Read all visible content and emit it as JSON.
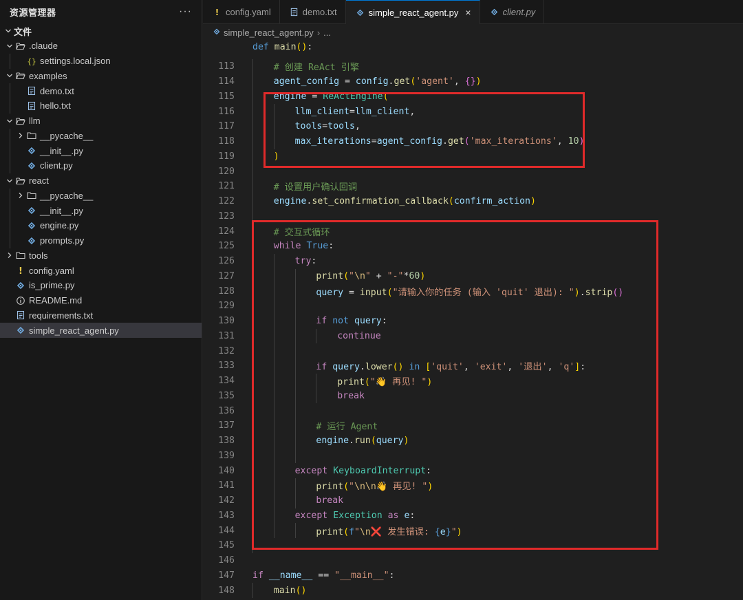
{
  "sidebar": {
    "title": "资源管理器",
    "more": "···",
    "section": "文件",
    "items": [
      {
        "label": ".claude",
        "depth": 1,
        "kind": "folder-open",
        "icon": "folder-icon"
      },
      {
        "label": "settings.local.json",
        "depth": 2,
        "kind": "json",
        "icon": "json-file-icon"
      },
      {
        "label": "examples",
        "depth": 1,
        "kind": "folder-open",
        "icon": "folder-icon"
      },
      {
        "label": "demo.txt",
        "depth": 2,
        "kind": "txt",
        "icon": "text-file-icon"
      },
      {
        "label": "hello.txt",
        "depth": 2,
        "kind": "txt",
        "icon": "text-file-icon"
      },
      {
        "label": "llm",
        "depth": 1,
        "kind": "folder-open",
        "icon": "folder-icon"
      },
      {
        "label": "__pycache__",
        "depth": 2,
        "kind": "folder-closed",
        "icon": "folder-icon"
      },
      {
        "label": "__init__.py",
        "depth": 2,
        "kind": "py",
        "icon": "python-file-icon"
      },
      {
        "label": "client.py",
        "depth": 2,
        "kind": "py",
        "icon": "python-file-icon"
      },
      {
        "label": "react",
        "depth": 1,
        "kind": "folder-open",
        "icon": "folder-icon"
      },
      {
        "label": "__pycache__",
        "depth": 2,
        "kind": "folder-closed",
        "icon": "folder-icon"
      },
      {
        "label": "__init__.py",
        "depth": 2,
        "kind": "py",
        "icon": "python-file-icon"
      },
      {
        "label": "engine.py",
        "depth": 2,
        "kind": "py",
        "icon": "python-file-icon"
      },
      {
        "label": "prompts.py",
        "depth": 2,
        "kind": "py",
        "icon": "python-file-icon"
      },
      {
        "label": "tools",
        "depth": 1,
        "kind": "folder-closed",
        "icon": "folder-icon"
      },
      {
        "label": "config.yaml",
        "depth": 1,
        "kind": "yaml",
        "icon": "yaml-file-icon"
      },
      {
        "label": "is_prime.py",
        "depth": 1,
        "kind": "py",
        "icon": "python-file-icon"
      },
      {
        "label": "README.md",
        "depth": 1,
        "kind": "md",
        "icon": "info-icon"
      },
      {
        "label": "requirements.txt",
        "depth": 1,
        "kind": "txt",
        "icon": "text-file-icon"
      },
      {
        "label": "simple_react_agent.py",
        "depth": 1,
        "kind": "py",
        "icon": "python-file-icon",
        "selected": true
      }
    ]
  },
  "tabs": [
    {
      "label": "config.yaml",
      "icon": "yaml-file-icon",
      "active": false,
      "italic": false
    },
    {
      "label": "demo.txt",
      "icon": "text-file-icon",
      "active": false,
      "italic": false
    },
    {
      "label": "simple_react_agent.py",
      "icon": "python-file-icon",
      "active": true,
      "italic": false,
      "close": "×"
    },
    {
      "label": "client.py",
      "icon": "python-file-icon",
      "active": false,
      "italic": true
    }
  ],
  "breadcrumb": {
    "file": "simple_react_agent.py",
    "sep": "›",
    "rest": "..."
  },
  "sticky_line": {
    "code": "def main():"
  },
  "colors": {
    "accent": "#0078d4",
    "highlight_box": "#e02a2a",
    "background": "#1f1f1f",
    "sidebar": "#181818"
  },
  "editor": {
    "lines": [
      {
        "n": "113",
        "indent": 1,
        "tokens": [
          [
            "cm",
            "# 创建 ReAct 引擎"
          ]
        ]
      },
      {
        "n": "114",
        "indent": 1,
        "tokens": [
          [
            "vr",
            "agent_config"
          ],
          [
            "op",
            " = "
          ],
          [
            "vr",
            "config"
          ],
          [
            "op",
            "."
          ],
          [
            "fn",
            "get"
          ],
          [
            "pb",
            "("
          ],
          [
            "st",
            "'agent'"
          ],
          [
            "op",
            ", "
          ],
          [
            "pp",
            "{}"
          ],
          [
            "pb",
            ")"
          ]
        ]
      },
      {
        "n": "115",
        "indent": 1,
        "tokens": [
          [
            "vr",
            "engine"
          ],
          [
            "op",
            " = "
          ],
          [
            "cls",
            "ReActEngine"
          ],
          [
            "pb",
            "("
          ]
        ]
      },
      {
        "n": "116",
        "indent": 2,
        "tokens": [
          [
            "vr",
            "llm_client"
          ],
          [
            "op",
            "="
          ],
          [
            "vr",
            "llm_client"
          ],
          [
            "op",
            ","
          ]
        ]
      },
      {
        "n": "117",
        "indent": 2,
        "tokens": [
          [
            "vr",
            "tools"
          ],
          [
            "op",
            "="
          ],
          [
            "vr",
            "tools"
          ],
          [
            "op",
            ","
          ]
        ]
      },
      {
        "n": "118",
        "indent": 2,
        "tokens": [
          [
            "vr",
            "max_iterations"
          ],
          [
            "op",
            "="
          ],
          [
            "vr",
            "agent_config"
          ],
          [
            "op",
            "."
          ],
          [
            "fn",
            "get"
          ],
          [
            "pp",
            "("
          ],
          [
            "st",
            "'max_iterations'"
          ],
          [
            "op",
            ", "
          ],
          [
            "nm",
            "10"
          ],
          [
            "pp",
            ")"
          ]
        ]
      },
      {
        "n": "119",
        "indent": 1,
        "tokens": [
          [
            "pb",
            ")"
          ]
        ]
      },
      {
        "n": "120",
        "indent": 1,
        "tokens": []
      },
      {
        "n": "121",
        "indent": 1,
        "tokens": [
          [
            "cm",
            "# 设置用户确认回调"
          ]
        ]
      },
      {
        "n": "122",
        "indent": 1,
        "tokens": [
          [
            "vr",
            "engine"
          ],
          [
            "op",
            "."
          ],
          [
            "fn",
            "set_confirmation_callback"
          ],
          [
            "pb",
            "("
          ],
          [
            "vr",
            "confirm_action"
          ],
          [
            "pb",
            ")"
          ]
        ]
      },
      {
        "n": "123",
        "indent": 1,
        "tokens": []
      },
      {
        "n": "124",
        "indent": 1,
        "tokens": [
          [
            "cm",
            "# 交互式循环"
          ]
        ]
      },
      {
        "n": "125",
        "indent": 1,
        "tokens": [
          [
            "kw",
            "while"
          ],
          [
            "op",
            " "
          ],
          [
            "kwb",
            "True"
          ],
          [
            "op",
            ":"
          ]
        ]
      },
      {
        "n": "126",
        "indent": 2,
        "tokens": [
          [
            "kw",
            "try"
          ],
          [
            "op",
            ":"
          ]
        ]
      },
      {
        "n": "127",
        "indent": 3,
        "tokens": [
          [
            "fn",
            "print"
          ],
          [
            "pb",
            "("
          ],
          [
            "st",
            "\""
          ],
          [
            "es",
            "\\n"
          ],
          [
            "st",
            "\""
          ],
          [
            "op",
            " + "
          ],
          [
            "st",
            "\"-\""
          ],
          [
            "op",
            "*"
          ],
          [
            "nm",
            "60"
          ],
          [
            "pb",
            ")"
          ]
        ]
      },
      {
        "n": "128",
        "indent": 3,
        "tokens": [
          [
            "vr",
            "query"
          ],
          [
            "op",
            " = "
          ],
          [
            "fn",
            "input"
          ],
          [
            "pb",
            "("
          ],
          [
            "st",
            "\"请输入你的任务 (输入 'quit' 退出): \""
          ],
          [
            "pb",
            ")"
          ],
          [
            "op",
            "."
          ],
          [
            "fn",
            "strip"
          ],
          [
            "pp",
            "()"
          ]
        ]
      },
      {
        "n": "129",
        "indent": 3,
        "tokens": []
      },
      {
        "n": "130",
        "indent": 3,
        "tokens": [
          [
            "kw",
            "if"
          ],
          [
            "op",
            " "
          ],
          [
            "kwb",
            "not"
          ],
          [
            "op",
            " "
          ],
          [
            "vr",
            "query"
          ],
          [
            "op",
            ":"
          ]
        ]
      },
      {
        "n": "131",
        "indent": 4,
        "tokens": [
          [
            "kw",
            "continue"
          ]
        ]
      },
      {
        "n": "132",
        "indent": 3,
        "tokens": []
      },
      {
        "n": "133",
        "indent": 3,
        "tokens": [
          [
            "kw",
            "if"
          ],
          [
            "op",
            " "
          ],
          [
            "vr",
            "query"
          ],
          [
            "op",
            "."
          ],
          [
            "fn",
            "lower"
          ],
          [
            "pb",
            "()"
          ],
          [
            "op",
            " "
          ],
          [
            "kwb",
            "in"
          ],
          [
            "op",
            " "
          ],
          [
            "pb",
            "["
          ],
          [
            "st",
            "'quit'"
          ],
          [
            "op",
            ", "
          ],
          [
            "st",
            "'exit'"
          ],
          [
            "op",
            ", "
          ],
          [
            "st",
            "'退出'"
          ],
          [
            "op",
            ", "
          ],
          [
            "st",
            "'q'"
          ],
          [
            "pb",
            "]"
          ],
          [
            "op",
            ":"
          ]
        ]
      },
      {
        "n": "134",
        "indent": 4,
        "tokens": [
          [
            "fn",
            "print"
          ],
          [
            "pb",
            "("
          ],
          [
            "st",
            "\"👋 再见! \""
          ],
          [
            "pb",
            ")"
          ]
        ]
      },
      {
        "n": "135",
        "indent": 4,
        "tokens": [
          [
            "kw",
            "break"
          ]
        ]
      },
      {
        "n": "136",
        "indent": 3,
        "tokens": []
      },
      {
        "n": "137",
        "indent": 3,
        "tokens": [
          [
            "cm",
            "# 运行 Agent"
          ]
        ]
      },
      {
        "n": "138",
        "indent": 3,
        "tokens": [
          [
            "vr",
            "engine"
          ],
          [
            "op",
            "."
          ],
          [
            "fn",
            "run"
          ],
          [
            "pb",
            "("
          ],
          [
            "vr",
            "query"
          ],
          [
            "pb",
            ")"
          ]
        ]
      },
      {
        "n": "139",
        "indent": 3,
        "tokens": []
      },
      {
        "n": "140",
        "indent": 2,
        "tokens": [
          [
            "kw",
            "except"
          ],
          [
            "op",
            " "
          ],
          [
            "cls",
            "KeyboardInterrupt"
          ],
          [
            "op",
            ":"
          ]
        ]
      },
      {
        "n": "141",
        "indent": 3,
        "tokens": [
          [
            "fn",
            "print"
          ],
          [
            "pb",
            "("
          ],
          [
            "st",
            "\""
          ],
          [
            "es",
            "\\n\\n"
          ],
          [
            "st",
            "👋 再见! \""
          ],
          [
            "pb",
            ")"
          ]
        ]
      },
      {
        "n": "142",
        "indent": 3,
        "tokens": [
          [
            "kw",
            "break"
          ]
        ]
      },
      {
        "n": "143",
        "indent": 2,
        "tokens": [
          [
            "kw",
            "except"
          ],
          [
            "op",
            " "
          ],
          [
            "cls",
            "Exception"
          ],
          [
            "op",
            " "
          ],
          [
            "kw",
            "as"
          ],
          [
            "op",
            " "
          ],
          [
            "vr",
            "e"
          ],
          [
            "op",
            ":"
          ]
        ]
      },
      {
        "n": "144",
        "indent": 3,
        "tokens": [
          [
            "fn",
            "print"
          ],
          [
            "pb",
            "("
          ],
          [
            "kwb",
            "f"
          ],
          [
            "st",
            "\""
          ],
          [
            "es",
            "\\n"
          ],
          [
            "st",
            "❌ 发生错误: "
          ],
          [
            "kwb",
            "{"
          ],
          [
            "vr",
            "e"
          ],
          [
            "kwb",
            "}"
          ],
          [
            "st",
            "\""
          ],
          [
            "pb",
            ")"
          ]
        ]
      },
      {
        "n": "145",
        "indent": 1,
        "tokens": []
      },
      {
        "n": "146",
        "indent": 0,
        "tokens": []
      },
      {
        "n": "147",
        "indent": 0,
        "tokens": [
          [
            "kw",
            "if"
          ],
          [
            "op",
            " "
          ],
          [
            "vr",
            "__name__"
          ],
          [
            "op",
            " == "
          ],
          [
            "st",
            "\"__main__\""
          ],
          [
            "op",
            ":"
          ]
        ]
      },
      {
        "n": "148",
        "indent": 1,
        "tokens": [
          [
            "fn",
            "main"
          ],
          [
            "pb",
            "()"
          ]
        ]
      }
    ]
  }
}
